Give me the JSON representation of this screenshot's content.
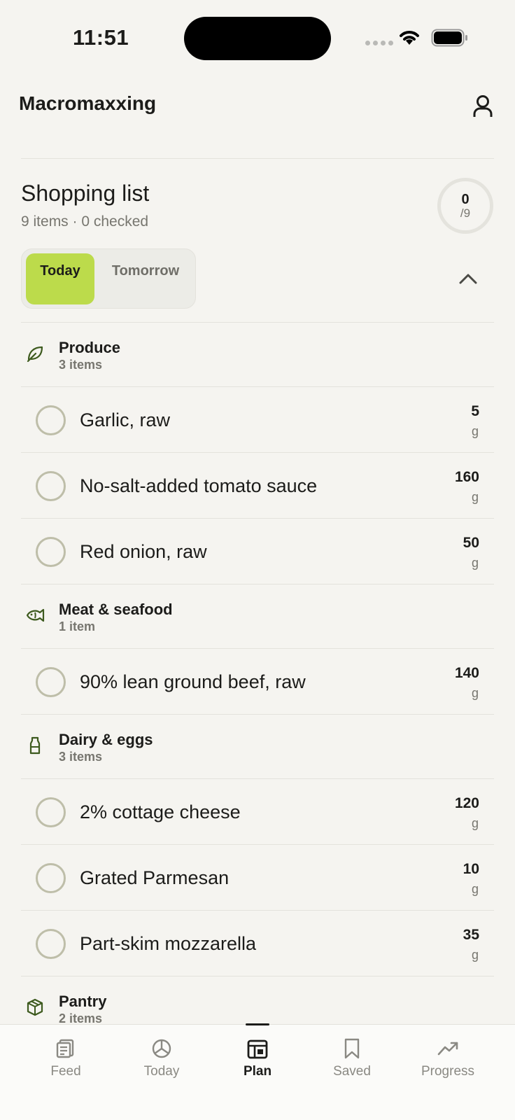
{
  "status_bar": {
    "time": "11:51"
  },
  "header": {
    "title": "Macromaxxing",
    "profile_icon": "person-icon"
  },
  "shopping": {
    "title": "Shopping list",
    "subtitle": "9 items · 0 checked",
    "progress_checked": "0",
    "progress_total": "/9"
  },
  "segment": {
    "today": "Today",
    "tomorrow": "Tomorrow",
    "selected": "Today",
    "accent_color": "#bcdb4b"
  },
  "categories": [
    {
      "name": "Produce",
      "count": "3 items",
      "icon": "leaf-icon",
      "items": [
        {
          "name": "Garlic, raw",
          "qty": "5",
          "unit": "g"
        },
        {
          "name": "No-salt-added tomato sauce",
          "qty": "160",
          "unit": "g"
        },
        {
          "name": "Red onion, raw",
          "qty": "50",
          "unit": "g"
        }
      ]
    },
    {
      "name": "Meat & seafood",
      "count": "1 item",
      "icon": "fish-icon",
      "items": [
        {
          "name": "90% lean ground beef, raw",
          "qty": "140",
          "unit": "g"
        }
      ]
    },
    {
      "name": "Dairy & eggs",
      "count": "3 items",
      "icon": "milk-bottle-icon",
      "items": [
        {
          "name": "2% cottage cheese",
          "qty": "120",
          "unit": "g"
        },
        {
          "name": "Grated Parmesan",
          "qty": "10",
          "unit": "g"
        },
        {
          "name": "Part-skim mozzarella",
          "qty": "35",
          "unit": "g"
        }
      ]
    },
    {
      "name": "Pantry",
      "count": "2 items",
      "icon": "box-icon",
      "items": []
    }
  ],
  "tabs": [
    {
      "label": "Feed",
      "icon": "feed-icon"
    },
    {
      "label": "Today",
      "icon": "today-icon"
    },
    {
      "label": "Plan",
      "icon": "plan-icon",
      "active": true
    },
    {
      "label": "Saved",
      "icon": "bookmark-icon"
    },
    {
      "label": "Progress",
      "icon": "trend-icon"
    }
  ]
}
